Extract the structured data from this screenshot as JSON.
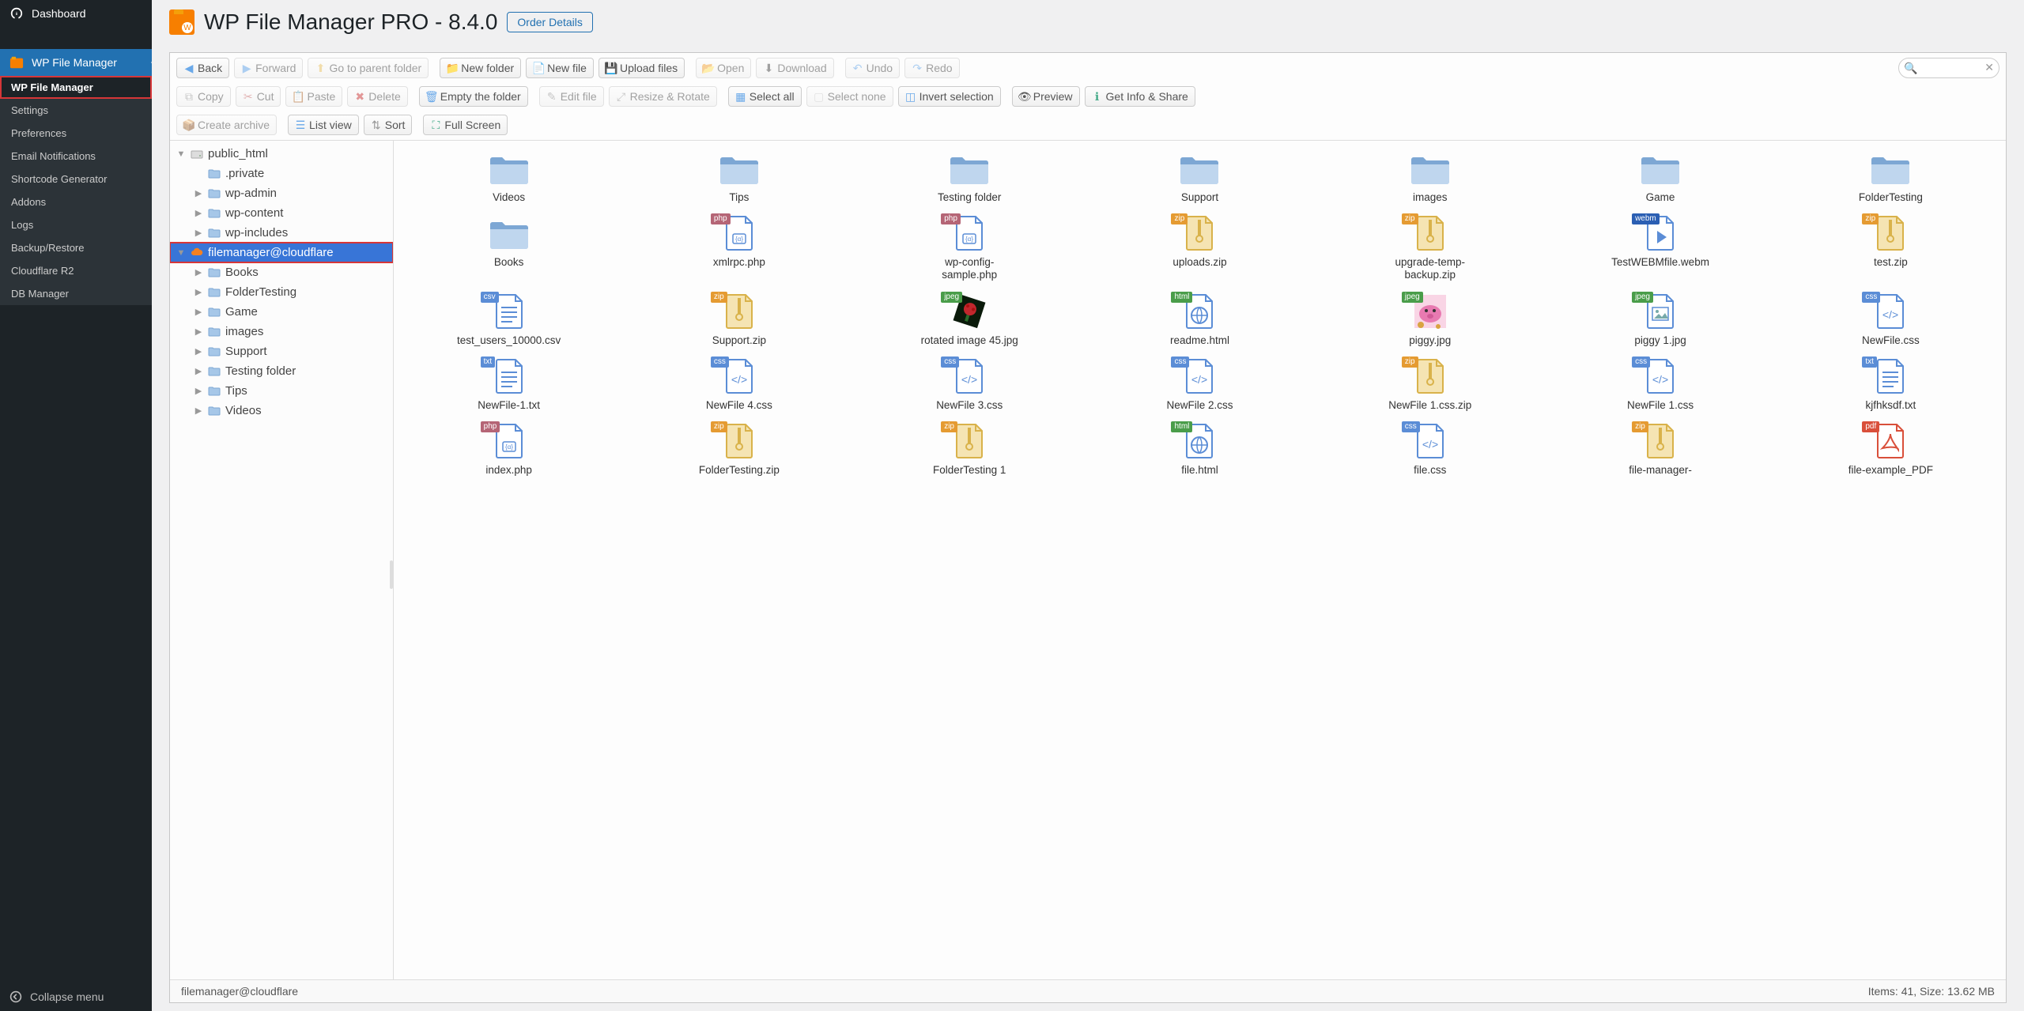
{
  "sidebar": {
    "dashboard": "Dashboard",
    "wp_file_manager": "WP File Manager",
    "submenu": [
      "WP File Manager",
      "Settings",
      "Preferences",
      "Email Notifications",
      "Shortcode Generator",
      "Addons",
      "Logs",
      "Backup/Restore",
      "Cloudflare R2",
      "DB Manager"
    ],
    "collapse": "Collapse menu"
  },
  "header": {
    "title": "WP File Manager PRO - 8.4.0",
    "order": "Order Details"
  },
  "toolbar": {
    "back": "Back",
    "forward": "Forward",
    "up": "Go to parent folder",
    "newfolder": "New folder",
    "newfile": "New file",
    "upload": "Upload files",
    "open": "Open",
    "download": "Download",
    "undo": "Undo",
    "redo": "Redo",
    "copy": "Copy",
    "cut": "Cut",
    "paste": "Paste",
    "delete": "Delete",
    "empty": "Empty the folder",
    "edit": "Edit file",
    "resize": "Resize & Rotate",
    "selectall": "Select all",
    "selectnone": "Select none",
    "invert": "Invert selection",
    "preview": "Preview",
    "info": "Get Info & Share",
    "archive": "Create archive",
    "list": "List view",
    "sort": "Sort",
    "fullscreen": "Full Screen",
    "search_placeholder": ""
  },
  "tree": [
    {
      "label": "public_html",
      "depth": 0,
      "icon": "disk",
      "open": true
    },
    {
      "label": ".private",
      "depth": 1,
      "icon": "folder"
    },
    {
      "label": "wp-admin",
      "depth": 1,
      "icon": "folder",
      "arrow": true
    },
    {
      "label": "wp-content",
      "depth": 1,
      "icon": "folder",
      "arrow": true
    },
    {
      "label": "wp-includes",
      "depth": 1,
      "icon": "folder",
      "arrow": true
    },
    {
      "label": "filemanager@cloudflare",
      "depth": 0,
      "icon": "cloud",
      "open": true,
      "selected": true,
      "boxed": true
    },
    {
      "label": "Books",
      "depth": 1,
      "icon": "folder",
      "arrow": true
    },
    {
      "label": "FolderTesting",
      "depth": 1,
      "icon": "folder",
      "arrow": true
    },
    {
      "label": "Game",
      "depth": 1,
      "icon": "folder",
      "arrow": true
    },
    {
      "label": "images",
      "depth": 1,
      "icon": "folder",
      "arrow": true
    },
    {
      "label": "Support",
      "depth": 1,
      "icon": "folder",
      "arrow": true
    },
    {
      "label": "Testing folder",
      "depth": 1,
      "icon": "folder",
      "arrow": true
    },
    {
      "label": "Tips",
      "depth": 1,
      "icon": "folder",
      "arrow": true
    },
    {
      "label": "Videos",
      "depth": 1,
      "icon": "folder",
      "arrow": true
    }
  ],
  "files": [
    {
      "label": "Videos",
      "type": "folder"
    },
    {
      "label": "Tips",
      "type": "folder"
    },
    {
      "label": "Testing folder",
      "type": "folder"
    },
    {
      "label": "Support",
      "type": "folder"
    },
    {
      "label": "images",
      "type": "folder"
    },
    {
      "label": "Game",
      "type": "folder"
    },
    {
      "label": "FolderTesting",
      "type": "folder"
    },
    {
      "label": "Books",
      "type": "folder"
    },
    {
      "label": "xmlrpc.php",
      "type": "php",
      "badge": "php",
      "bcolor": "#b56576"
    },
    {
      "label": "wp-config-sample.php",
      "type": "php",
      "badge": "php",
      "bcolor": "#b56576"
    },
    {
      "label": "uploads.zip",
      "type": "zip",
      "badge": "zip",
      "bcolor": "#e59b32"
    },
    {
      "label": "upgrade-temp-backup.zip",
      "type": "zip",
      "badge": "zip",
      "bcolor": "#e59b32"
    },
    {
      "label": "TestWEBMfile.webm",
      "type": "media",
      "badge": "webm",
      "bcolor": "#2b5fb3"
    },
    {
      "label": "test.zip",
      "type": "zip",
      "badge": "zip",
      "bcolor": "#e59b32"
    },
    {
      "label": "test_users_10000.csv",
      "type": "csv",
      "badge": "csv",
      "bcolor": "#5b8dd6"
    },
    {
      "label": "Support.zip",
      "type": "zip",
      "badge": "zip",
      "bcolor": "#e59b32"
    },
    {
      "label": "rotated image 45.jpg",
      "type": "jpeg-rot",
      "badge": "jpeg",
      "bcolor": "#4a9d4a"
    },
    {
      "label": "readme.html",
      "type": "html",
      "badge": "html",
      "bcolor": "#4a9d4a"
    },
    {
      "label": "piggy.jpg",
      "type": "jpeg-pig",
      "badge": "jpeg",
      "bcolor": "#4a9d4a"
    },
    {
      "label": "piggy 1.jpg",
      "type": "jpeg-img",
      "badge": "jpeg",
      "bcolor": "#4a9d4a"
    },
    {
      "label": "NewFile.css",
      "type": "css",
      "badge": "css",
      "bcolor": "#5b8dd6"
    },
    {
      "label": "NewFile-1.txt",
      "type": "txt",
      "badge": "txt",
      "bcolor": "#5b8dd6"
    },
    {
      "label": "NewFile 4.css",
      "type": "css",
      "badge": "css",
      "bcolor": "#5b8dd6"
    },
    {
      "label": "NewFile 3.css",
      "type": "css",
      "badge": "css",
      "bcolor": "#5b8dd6"
    },
    {
      "label": "NewFile 2.css",
      "type": "css",
      "badge": "css",
      "bcolor": "#5b8dd6"
    },
    {
      "label": "NewFile 1.css.zip",
      "type": "zip",
      "badge": "zip",
      "bcolor": "#e59b32"
    },
    {
      "label": "NewFile 1.css",
      "type": "css",
      "badge": "css",
      "bcolor": "#5b8dd6"
    },
    {
      "label": "kjfhksdf.txt",
      "type": "txt",
      "badge": "txt",
      "bcolor": "#5b8dd6"
    },
    {
      "label": "index.php",
      "type": "php",
      "badge": "php",
      "bcolor": "#b56576"
    },
    {
      "label": "FolderTesting.zip",
      "type": "zip",
      "badge": "zip",
      "bcolor": "#e59b32"
    },
    {
      "label": "FolderTesting 1",
      "type": "zip",
      "badge": "zip",
      "bcolor": "#e59b32"
    },
    {
      "label": "file.html",
      "type": "html",
      "badge": "html",
      "bcolor": "#4a9d4a"
    },
    {
      "label": "file.css",
      "type": "css",
      "badge": "css",
      "bcolor": "#5b8dd6"
    },
    {
      "label": "file-manager-",
      "type": "zip",
      "badge": "zip",
      "bcolor": "#e59b32"
    },
    {
      "label": "file-example_PDF",
      "type": "pdf",
      "badge": "pdf",
      "bcolor": "#d94f3a"
    }
  ],
  "status": {
    "left": "filemanager@cloudflare",
    "right": "Items: 41, Size: 13.62 MB"
  }
}
